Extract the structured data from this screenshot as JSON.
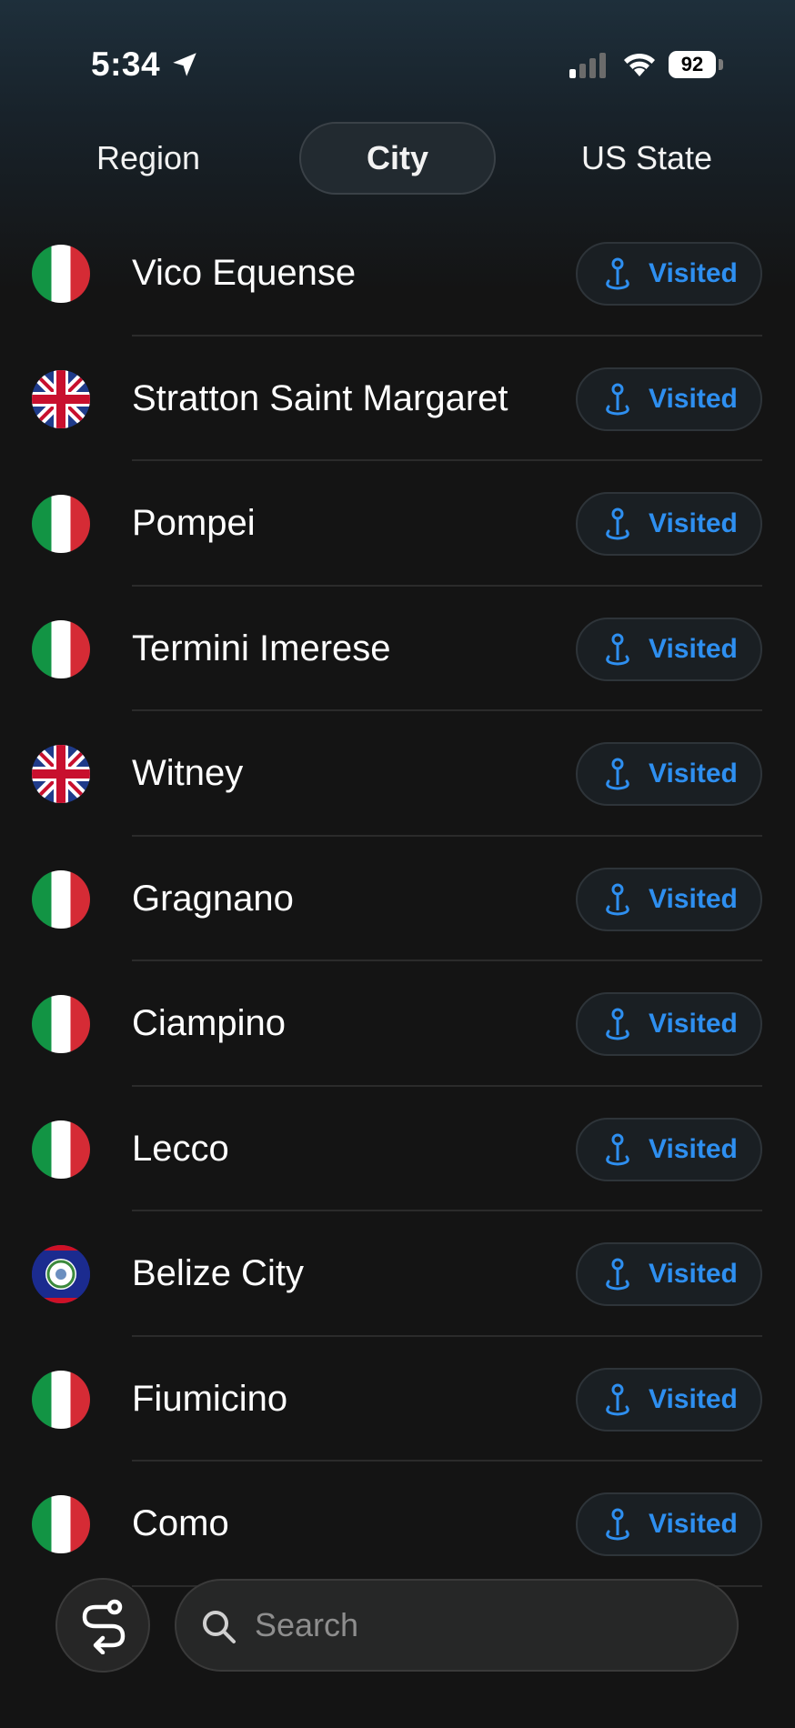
{
  "status_bar": {
    "time": "5:34",
    "battery": "92"
  },
  "tabs": [
    {
      "label": "Region",
      "selected": false
    },
    {
      "label": "City",
      "selected": true
    },
    {
      "label": "US State",
      "selected": false
    }
  ],
  "cities": [
    {
      "name": "Vico Equense",
      "flag": "italy-flag-icon",
      "status": "Visited"
    },
    {
      "name": "Stratton Saint Margaret",
      "flag": "uk-flag-icon",
      "status": "Visited"
    },
    {
      "name": "Pompei",
      "flag": "italy-flag-icon",
      "status": "Visited"
    },
    {
      "name": "Termini Imerese",
      "flag": "italy-flag-icon",
      "status": "Visited"
    },
    {
      "name": "Witney",
      "flag": "uk-flag-icon",
      "status": "Visited"
    },
    {
      "name": "Gragnano",
      "flag": "italy-flag-icon",
      "status": "Visited"
    },
    {
      "name": "Ciampino",
      "flag": "italy-flag-icon",
      "status": "Visited"
    },
    {
      "name": "Lecco",
      "flag": "italy-flag-icon",
      "status": "Visited"
    },
    {
      "name": "Belize City",
      "flag": "belize-flag-icon",
      "status": "Visited"
    },
    {
      "name": "Fiumicino",
      "flag": "italy-flag-icon",
      "status": "Visited"
    },
    {
      "name": "Como",
      "flag": "italy-flag-icon",
      "status": "Visited"
    }
  ],
  "search": {
    "placeholder": "Search"
  },
  "colors": {
    "accent": "#2e8ff0",
    "background": "#141414"
  }
}
